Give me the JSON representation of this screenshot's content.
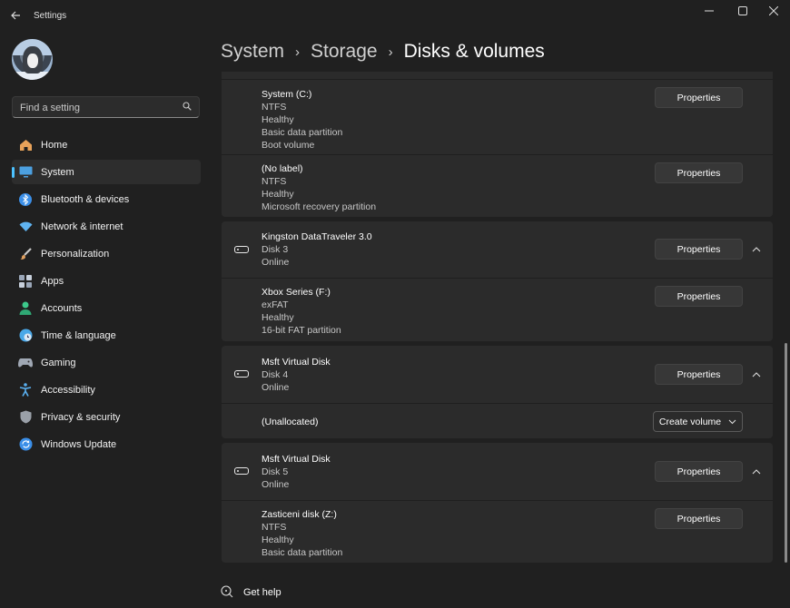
{
  "app": {
    "title": "Settings"
  },
  "search": {
    "placeholder": "Find a setting"
  },
  "nav": [
    {
      "label": "Home",
      "icon": "home-icon",
      "color": "#e8a25a"
    },
    {
      "label": "System",
      "icon": "monitor-icon",
      "color": "#4ca0e0"
    },
    {
      "label": "Bluetooth & devices",
      "icon": "bluetooth-icon",
      "color": "#3b8fe8"
    },
    {
      "label": "Network & internet",
      "icon": "wifi-icon",
      "color": "#5fb3f0"
    },
    {
      "label": "Personalization",
      "icon": "brush-icon",
      "color": "#e0a060"
    },
    {
      "label": "Apps",
      "icon": "apps-icon",
      "color": "#9aa6b8"
    },
    {
      "label": "Accounts",
      "icon": "person-icon",
      "color": "#3cc88a"
    },
    {
      "label": "Time & language",
      "icon": "globe-clock-icon",
      "color": "#4aa8e8"
    },
    {
      "label": "Gaming",
      "icon": "gamepad-icon",
      "color": "#a0a8b4"
    },
    {
      "label": "Accessibility",
      "icon": "accessibility-icon",
      "color": "#5ab0f0"
    },
    {
      "label": "Privacy & security",
      "icon": "shield-icon",
      "color": "#9aa0a8"
    },
    {
      "label": "Windows Update",
      "icon": "update-icon",
      "color": "#3b8fe8"
    }
  ],
  "breadcrumb": {
    "part1": "System",
    "part2": "Storage",
    "current": "Disks & volumes"
  },
  "volumes": {
    "system_c": {
      "lines": [
        "System (C:)",
        "NTFS",
        "Healthy",
        "Basic data partition",
        "Boot volume"
      ],
      "button": "Properties"
    },
    "no_label": {
      "lines": [
        "(No label)",
        "NTFS",
        "Healthy",
        "Microsoft recovery partition"
      ],
      "button": "Properties"
    },
    "kingston": {
      "lines": [
        "Kingston DataTraveler 3.0",
        "Disk 3",
        "Online"
      ],
      "button": "Properties"
    },
    "xbox": {
      "lines": [
        "Xbox Series (F:)",
        "exFAT",
        "Healthy",
        "16-bit FAT partition"
      ],
      "button": "Properties"
    },
    "msft4": {
      "lines": [
        "Msft Virtual Disk",
        "Disk 4",
        "Online"
      ],
      "button": "Properties"
    },
    "unalloc": {
      "lines": [
        "(Unallocated)"
      ],
      "button": "Create volume"
    },
    "msft5": {
      "lines": [
        "Msft Virtual Disk",
        "Disk 5",
        "Online"
      ],
      "button": "Properties"
    },
    "zdisk": {
      "lines": [
        "Zasticeni disk (Z:)",
        "NTFS",
        "Healthy",
        "Basic data partition"
      ],
      "button": "Properties"
    }
  },
  "help": {
    "label": "Get help"
  }
}
